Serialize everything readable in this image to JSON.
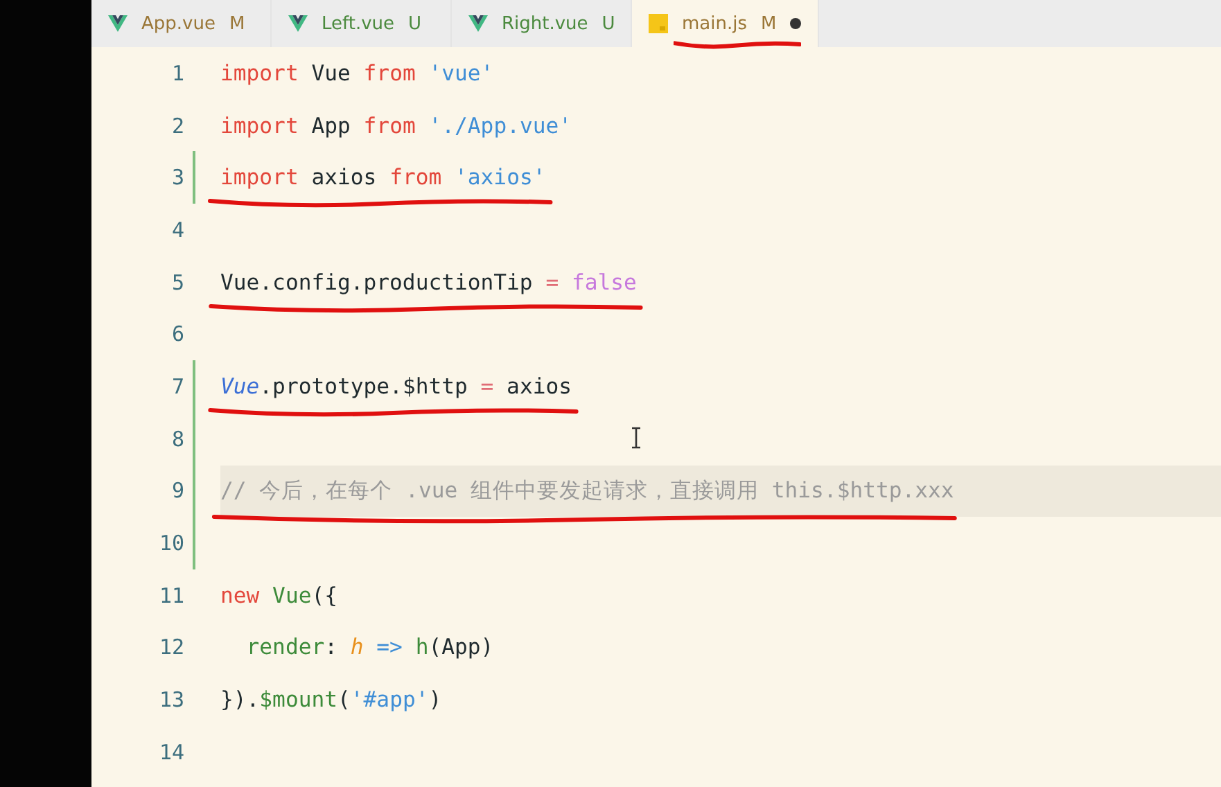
{
  "tabs": [
    {
      "kind": "vue",
      "label": "App.vue",
      "status": "M",
      "dirty": false,
      "selected": false,
      "annotated": false
    },
    {
      "kind": "vue",
      "label": "Left.vue",
      "status": "U",
      "dirty": false,
      "selected": false,
      "annotated": false
    },
    {
      "kind": "vue",
      "label": "Right.vue",
      "status": "U",
      "dirty": false,
      "selected": false,
      "annotated": false
    },
    {
      "kind": "js",
      "label": "main.js",
      "status": "M",
      "dirty": true,
      "selected": true,
      "annotated": true
    }
  ],
  "lines": [
    {
      "number": "1",
      "current": false,
      "changed": false,
      "annotated": false,
      "tokens": [
        {
          "kind": "keyword",
          "text": "import"
        },
        {
          "kind": "plain",
          "text": " Vue "
        },
        {
          "kind": "keyword",
          "text": "from "
        },
        {
          "kind": "string",
          "text": "'vue'"
        }
      ]
    },
    {
      "number": "2",
      "current": false,
      "changed": false,
      "annotated": false,
      "tokens": [
        {
          "kind": "keyword",
          "text": "import"
        },
        {
          "kind": "plain",
          "text": " App "
        },
        {
          "kind": "keyword",
          "text": "from "
        },
        {
          "kind": "string",
          "text": "'./App.vue'"
        }
      ]
    },
    {
      "number": "3",
      "current": false,
      "changed": true,
      "annotated": true,
      "tokens": [
        {
          "kind": "keyword",
          "text": "import"
        },
        {
          "kind": "plain",
          "text": " axios "
        },
        {
          "kind": "keyword",
          "text": "from "
        },
        {
          "kind": "string",
          "text": "'axios'"
        }
      ]
    },
    {
      "number": "4",
      "current": false,
      "changed": false
    },
    {
      "number": "5",
      "current": false,
      "changed": false,
      "annotated": true,
      "tokens": [
        {
          "kind": "plain",
          "text": "Vue.config.productionTip "
        },
        {
          "kind": "operator",
          "text": "= "
        },
        {
          "kind": "boolean",
          "text": "false"
        }
      ]
    },
    {
      "number": "6",
      "current": false,
      "changed": false
    },
    {
      "number": "7",
      "current": false,
      "changed": true,
      "annotated": true,
      "tokens": [
        {
          "kind": "class",
          "text": "Vue"
        },
        {
          "kind": "plain",
          "text": ".prototype.$http "
        },
        {
          "kind": "operator",
          "text": "="
        },
        {
          "kind": "plain",
          "text": " axios"
        }
      ]
    },
    {
      "number": "8",
      "current": false,
      "changed": true
    },
    {
      "number": "9",
      "current": true,
      "changed": true,
      "annotated": true,
      "tokens": [
        {
          "kind": "comment",
          "text": "// 今后，在每个 .vue 组件中要发起请求，直接调用 this.$http.xxx"
        }
      ]
    },
    {
      "number": "10",
      "current": false,
      "changed": true
    },
    {
      "number": "11",
      "current": false,
      "changed": false,
      "annotated": false,
      "tokens": [
        {
          "kind": "keyword",
          "text": "new"
        },
        {
          "kind": "function",
          "text": " Vue"
        },
        {
          "kind": "plain",
          "text": "({"
        }
      ]
    },
    {
      "number": "12",
      "current": false,
      "changed": false,
      "annotated": false,
      "tokens": [
        {
          "kind": "function",
          "text": "  render"
        },
        {
          "kind": "plain",
          "text": ": "
        },
        {
          "kind": "param",
          "text": "h"
        },
        {
          "kind": "arrow",
          "text": " => "
        },
        {
          "kind": "function",
          "text": "h"
        },
        {
          "kind": "plain",
          "text": "(App)"
        }
      ]
    },
    {
      "number": "13",
      "current": false,
      "changed": false,
      "annotated": false,
      "tokens": [
        {
          "kind": "plain",
          "text": "})."
        },
        {
          "kind": "function",
          "text": "$mount"
        },
        {
          "kind": "plain",
          "text": "("
        },
        {
          "kind": "string",
          "text": "'#app'"
        },
        {
          "kind": "plain",
          "text": ")"
        }
      ]
    },
    {
      "number": "14",
      "current": false,
      "changed": false
    }
  ]
}
